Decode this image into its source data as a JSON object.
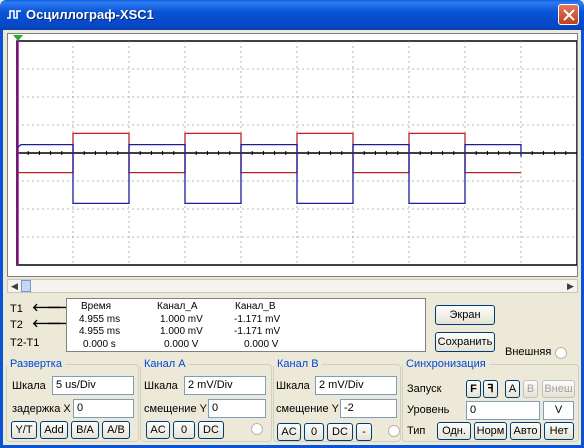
{
  "window": {
    "title": "Осциллограф-XSC1"
  },
  "colors": {
    "channel_a": "#c02020",
    "channel_b": "#1c1c9c",
    "cursor": "#c000c0",
    "grid": "#a0a0a0",
    "titlebar": "#0853d6"
  },
  "chart_data": {
    "type": "line",
    "title": "",
    "grid": true,
    "grid_divisions": {
      "x": 10,
      "y": 8
    },
    "timebase": "5 us/Div",
    "series": [
      {
        "channel": "A",
        "shape": "square-wave",
        "levels": [
          -0.7,
          0.7
        ],
        "offset_div": 0,
        "half_period_div": 1.0,
        "x_start_div": 1.0,
        "x_end_div": 9.0
      },
      {
        "channel": "B",
        "shape": "square-wave",
        "levels": [
          -1.8,
          0.3
        ],
        "offset_div": 0,
        "half_period_div": 1.0,
        "x_start_div": 0.0,
        "x_end_div": 9.0
      }
    ]
  },
  "cursors": {
    "t1_label": "T1",
    "t2_label": "T2",
    "t2t1_label": "T2-T1",
    "left_arrow": "🡐",
    "right_arrow": "🡒"
  },
  "readout": {
    "headers": [
      "Время",
      "Канал_A",
      "Канал_B"
    ],
    "rows": [
      [
        "4.955 ms",
        "1.000 mV",
        "-1.171 mV"
      ],
      [
        "4.955 ms",
        "1.000 mV",
        "-1.171 mV"
      ],
      [
        "0.000 s",
        "0.000 V",
        "0.000 V"
      ]
    ]
  },
  "right_buttons": {
    "screen": "Экран",
    "save": "Сохранить",
    "external": "Внешняя"
  },
  "timebase": {
    "legend": "Развертка",
    "scale_label": "Шкала",
    "scale_value": "5 us/Div",
    "delay_label": "задержка X",
    "delay_value": "0",
    "buttons": [
      "Y/T",
      "Add",
      "B/A",
      "A/B"
    ]
  },
  "channel_a": {
    "legend": "Канал А",
    "scale_label": "Шкала",
    "scale_value": "2 mV/Div",
    "offset_label": "смещение Y",
    "offset_value": "0",
    "buttons": [
      "AC",
      "0",
      "DC"
    ]
  },
  "channel_b": {
    "legend": "Канал В",
    "scale_label": "Шкала",
    "scale_value": "2 mV/Div",
    "offset_label": "смещение Y",
    "offset_value": "-2",
    "buttons": [
      "AC",
      "0",
      "DC",
      "-"
    ]
  },
  "trigger": {
    "legend": "Синхронизация",
    "start_label": "Запуск",
    "edge_buttons": [
      "F",
      "ꟻ"
    ],
    "source_buttons": [
      "A",
      "B",
      "Внеш"
    ],
    "level_label": "Уровень",
    "level_value": "0",
    "level_unit": "V",
    "type_label": "Тип",
    "type_buttons": [
      "Одн.",
      "Норм",
      "Авто",
      "Нет"
    ]
  }
}
